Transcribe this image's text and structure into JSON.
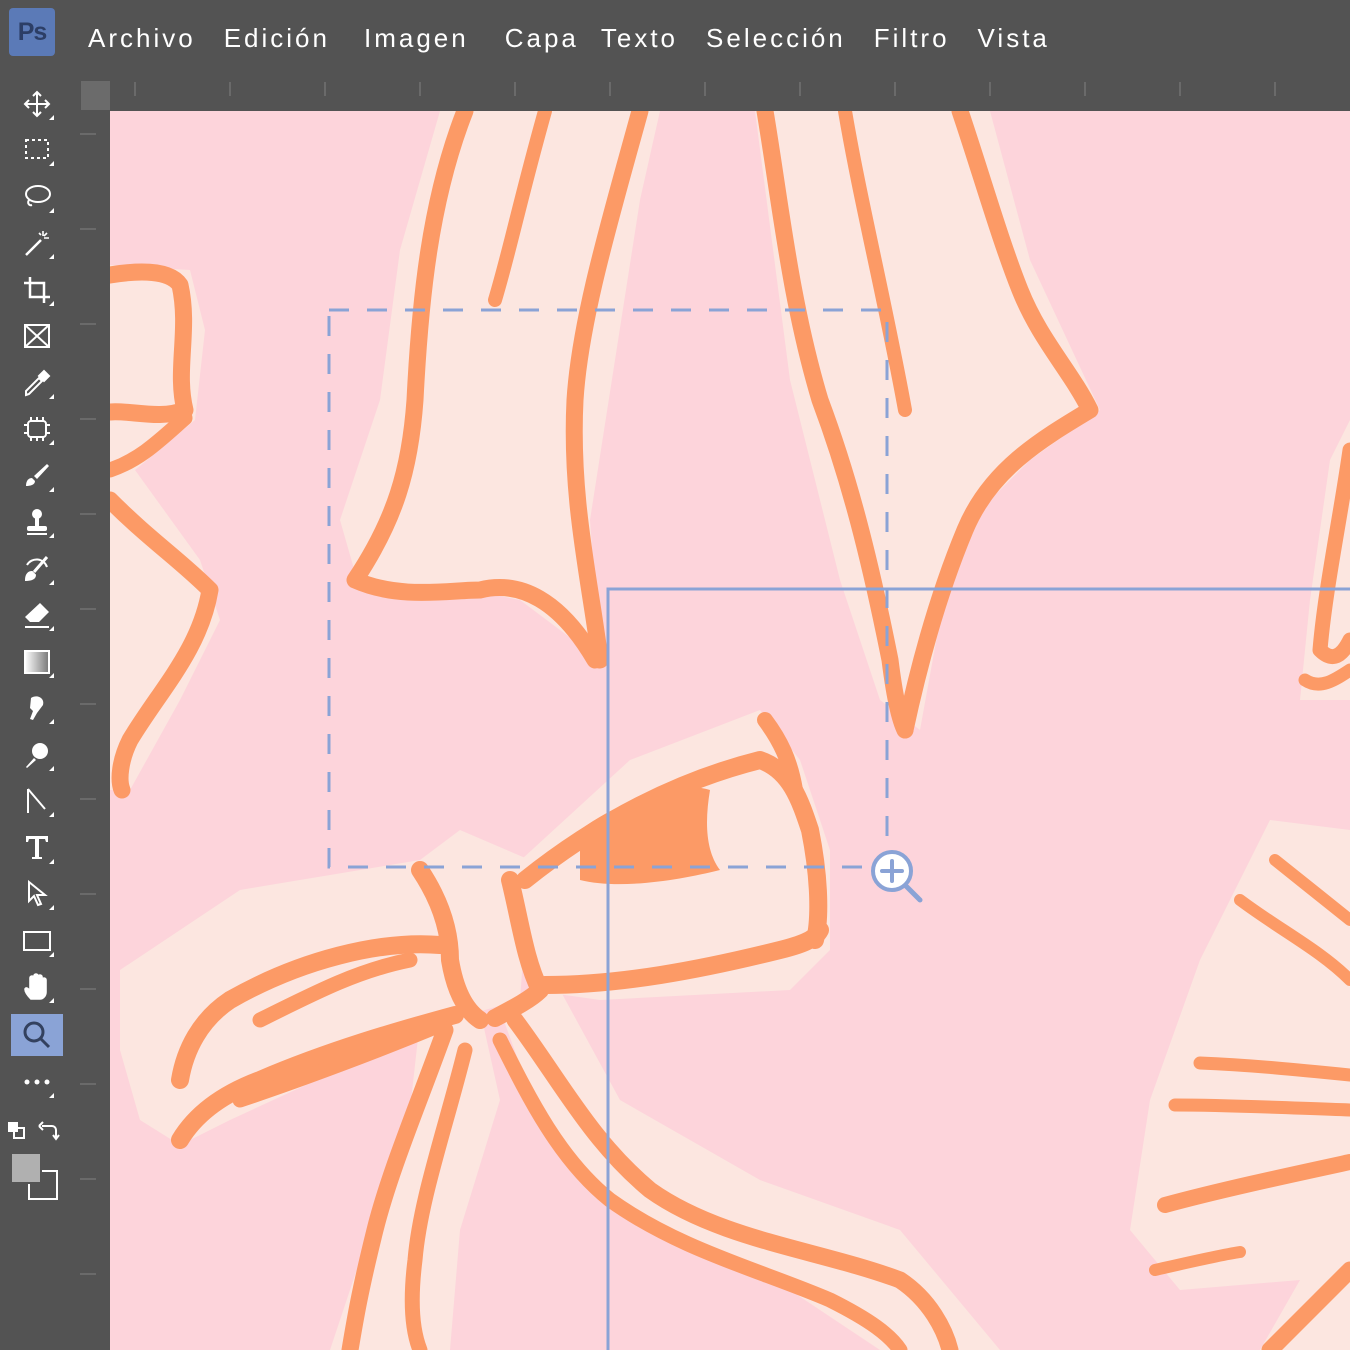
{
  "app": {
    "logo_text": "Ps",
    "menu": [
      "Archivo",
      "Edición",
      "Imagen",
      "Capa",
      "Texto",
      "Selección",
      "Filtro",
      "Vista"
    ]
  },
  "toolbar": {
    "tools": [
      {
        "name": "move-icon",
        "active": false
      },
      {
        "name": "rectangular-marquee-icon",
        "active": false
      },
      {
        "name": "lasso-icon",
        "active": false
      },
      {
        "name": "magic-wand-icon",
        "active": false
      },
      {
        "name": "crop-icon",
        "active": false
      },
      {
        "name": "frame-icon",
        "active": false
      },
      {
        "name": "eyedropper-icon",
        "active": false
      },
      {
        "name": "spot-healing-icon",
        "active": false
      },
      {
        "name": "brush-icon",
        "active": false
      },
      {
        "name": "clone-stamp-icon",
        "active": false
      },
      {
        "name": "history-brush-icon",
        "active": false
      },
      {
        "name": "eraser-icon",
        "active": false
      },
      {
        "name": "gradient-icon",
        "active": false
      },
      {
        "name": "smudge-icon",
        "active": false
      },
      {
        "name": "dodge-icon",
        "active": false
      },
      {
        "name": "pen-icon",
        "active": false
      },
      {
        "name": "type-icon",
        "active": false
      },
      {
        "name": "path-selection-icon",
        "active": false
      },
      {
        "name": "rectangle-icon",
        "active": false
      },
      {
        "name": "hand-icon",
        "active": false
      },
      {
        "name": "zoom-icon",
        "active": true
      },
      {
        "name": "more-tools-icon",
        "active": false
      }
    ]
  },
  "colors": {
    "chrome": "#535353",
    "canvas_bg": "#fdd4db",
    "ribbon_fill": "#fce6e0",
    "ribbon_stroke": "#fc9a66",
    "selection": "#8aa3d6",
    "active_tool": "#8aa3d6"
  },
  "canvas": {
    "cursor": "zoom-in-icon"
  }
}
